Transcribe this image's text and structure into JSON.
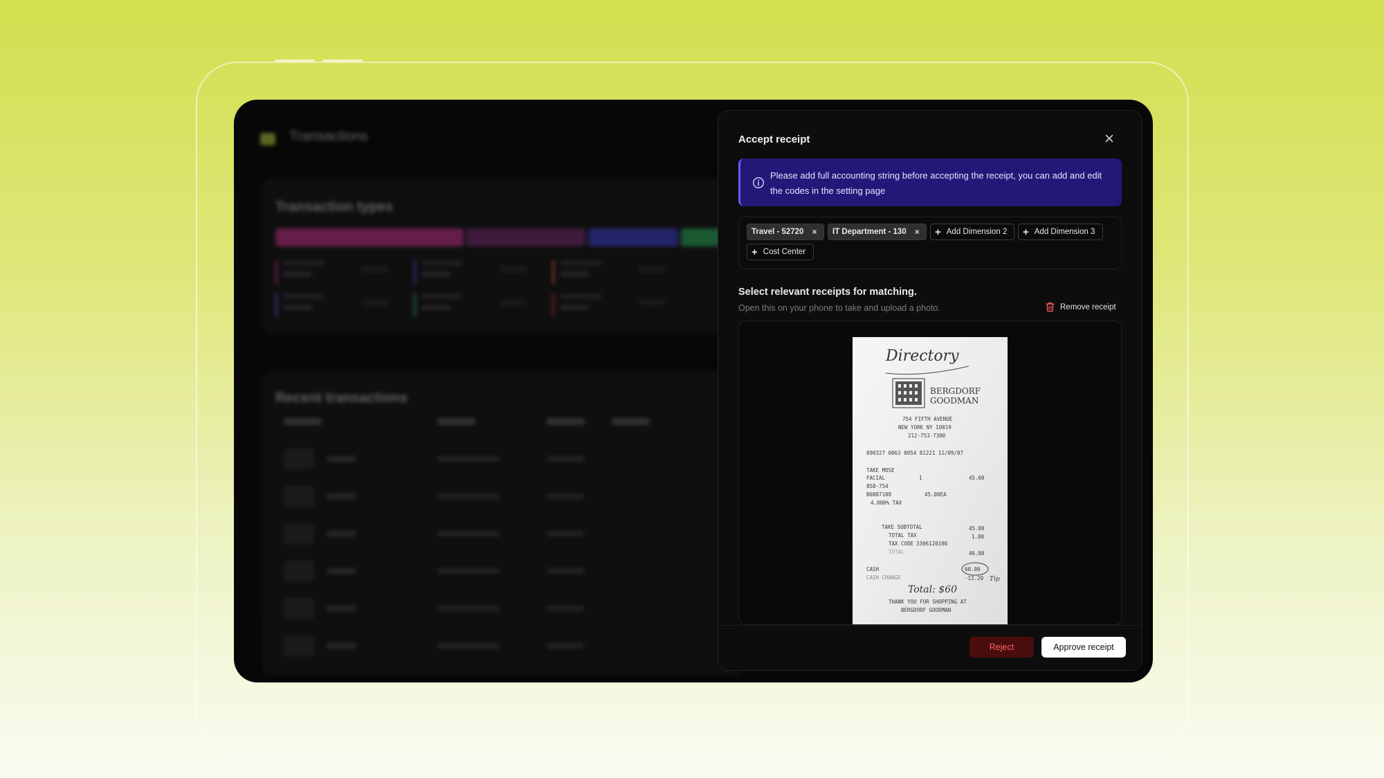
{
  "dialog": {
    "title": "Accept receipt",
    "close_icon": "close-icon",
    "info_text": "Please add full accounting string before accepting the receipt, you can add and edit the codes in the setting page",
    "info_icon": "info-circle-icon",
    "dimensions": {
      "selected": [
        {
          "label": "Travel - 52720"
        },
        {
          "label": "IT Department - 130"
        }
      ],
      "add_buttons": [
        {
          "label": "Add Dimension 2"
        },
        {
          "label": "Add Dimension 3"
        },
        {
          "label": "Cost Center"
        }
      ]
    },
    "section_title": "Select relevant receipts for matching.",
    "section_subtitle": "Open this on your phone to take and upload a photo.",
    "remove_label": "Remove receipt",
    "remove_icon": "trash-icon",
    "receipt": {
      "handwritten_header": "Directory",
      "store_name_line1": "BERGDORF",
      "store_name_line2": "GOODMAN",
      "address1": "754 FIFTH AVENUE",
      "address2": "NEW YORK NY 10019",
      "phone": "212-753-7300",
      "ref_line": "890327 0063 0054 81221 11/09/07",
      "dept": "TAKE MOSE",
      "item1_name": "FACIAL",
      "item1_qty": "1",
      "item1_price": "45.00",
      "item2_code": "858-754",
      "item3_code": "B0887108",
      "item3_price": "45.00EA",
      "tax_rate": "4.000% TAX",
      "subtotal_label": "TAKE SUBTOTAL",
      "subtotal_value": "45.00",
      "total_tax_label": "TOTAL TAX",
      "total_tax_value": "1.80",
      "tax_code_label": "TAX CODE",
      "tax_code_value": "3306120100",
      "total_label": "TOTAL",
      "total_value": "46.80",
      "cash_label": "CASH",
      "cash_value": "60.00",
      "cash_change_label": "CASH CHANGE",
      "cash_change_value": "-13.20",
      "handwritten_tip": "Tip",
      "handwritten_total": "Total: $60",
      "thanks_line1": "THANK YOU FOR SHOPPING AT",
      "thanks_line2": "BERGDORF GOODMAN"
    },
    "reject_label": "Reject",
    "approve_label": "Approve receipt"
  },
  "background": {
    "app_title": "Transactions",
    "logo_icon": "app-logo-icon",
    "card1_title": "Transaction types",
    "card2_title": "Recent transactions",
    "type_bar_colors": [
      "#c0358c",
      "#7a2d74",
      "#3c3ec8",
      "#2fae5c"
    ],
    "stat_colors": [
      "#c0358c",
      "#4b4fd6",
      "#d8693a",
      "#a23070"
    ],
    "rows_count_label": ""
  },
  "colors": {
    "banner_bg": "#231878",
    "banner_accent": "#6b5bff",
    "reject_text": "#ff6262",
    "reject_bg": "#4a0d0d",
    "trash_icon": "#ff5a5a"
  }
}
